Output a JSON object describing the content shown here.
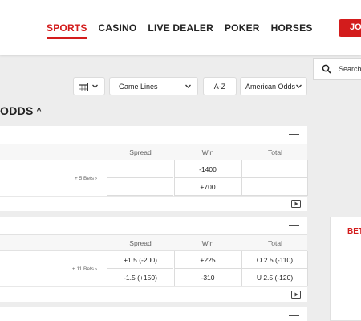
{
  "nav": {
    "items": [
      {
        "label": "SPORTS",
        "active": true
      },
      {
        "label": "CASINO"
      },
      {
        "label": "LIVE DEALER"
      },
      {
        "label": "POKER"
      },
      {
        "label": "HORSES"
      }
    ],
    "join_label": "JO"
  },
  "search": {
    "placeholder": "Search"
  },
  "controls": {
    "calendar_icon": "calendar-icon",
    "market": "Game Lines",
    "sort": "A-Z",
    "odds_format": "American Odds"
  },
  "section": {
    "title": "ODDS"
  },
  "columns": [
    "Spread",
    "Win",
    "Total"
  ],
  "events": [
    {
      "bets": "+ 5 Bets",
      "rows": [
        {
          "spread": "",
          "win": "-1400",
          "total": ""
        },
        {
          "spread": "",
          "win": "+700",
          "total": ""
        }
      ]
    },
    {
      "bets": "+ 11 Bets",
      "rows": [
        {
          "spread": "+1.5 (-200)",
          "win": "+225",
          "total": "O 2.5 (-110)"
        },
        {
          "spread": "-1.5 (+150)",
          "win": "-310",
          "total": "U 2.5 (-120)"
        }
      ]
    }
  ],
  "betslip": {
    "title": "BET"
  },
  "colors": {
    "accent": "#d31c1c",
    "background": "#ededed"
  }
}
